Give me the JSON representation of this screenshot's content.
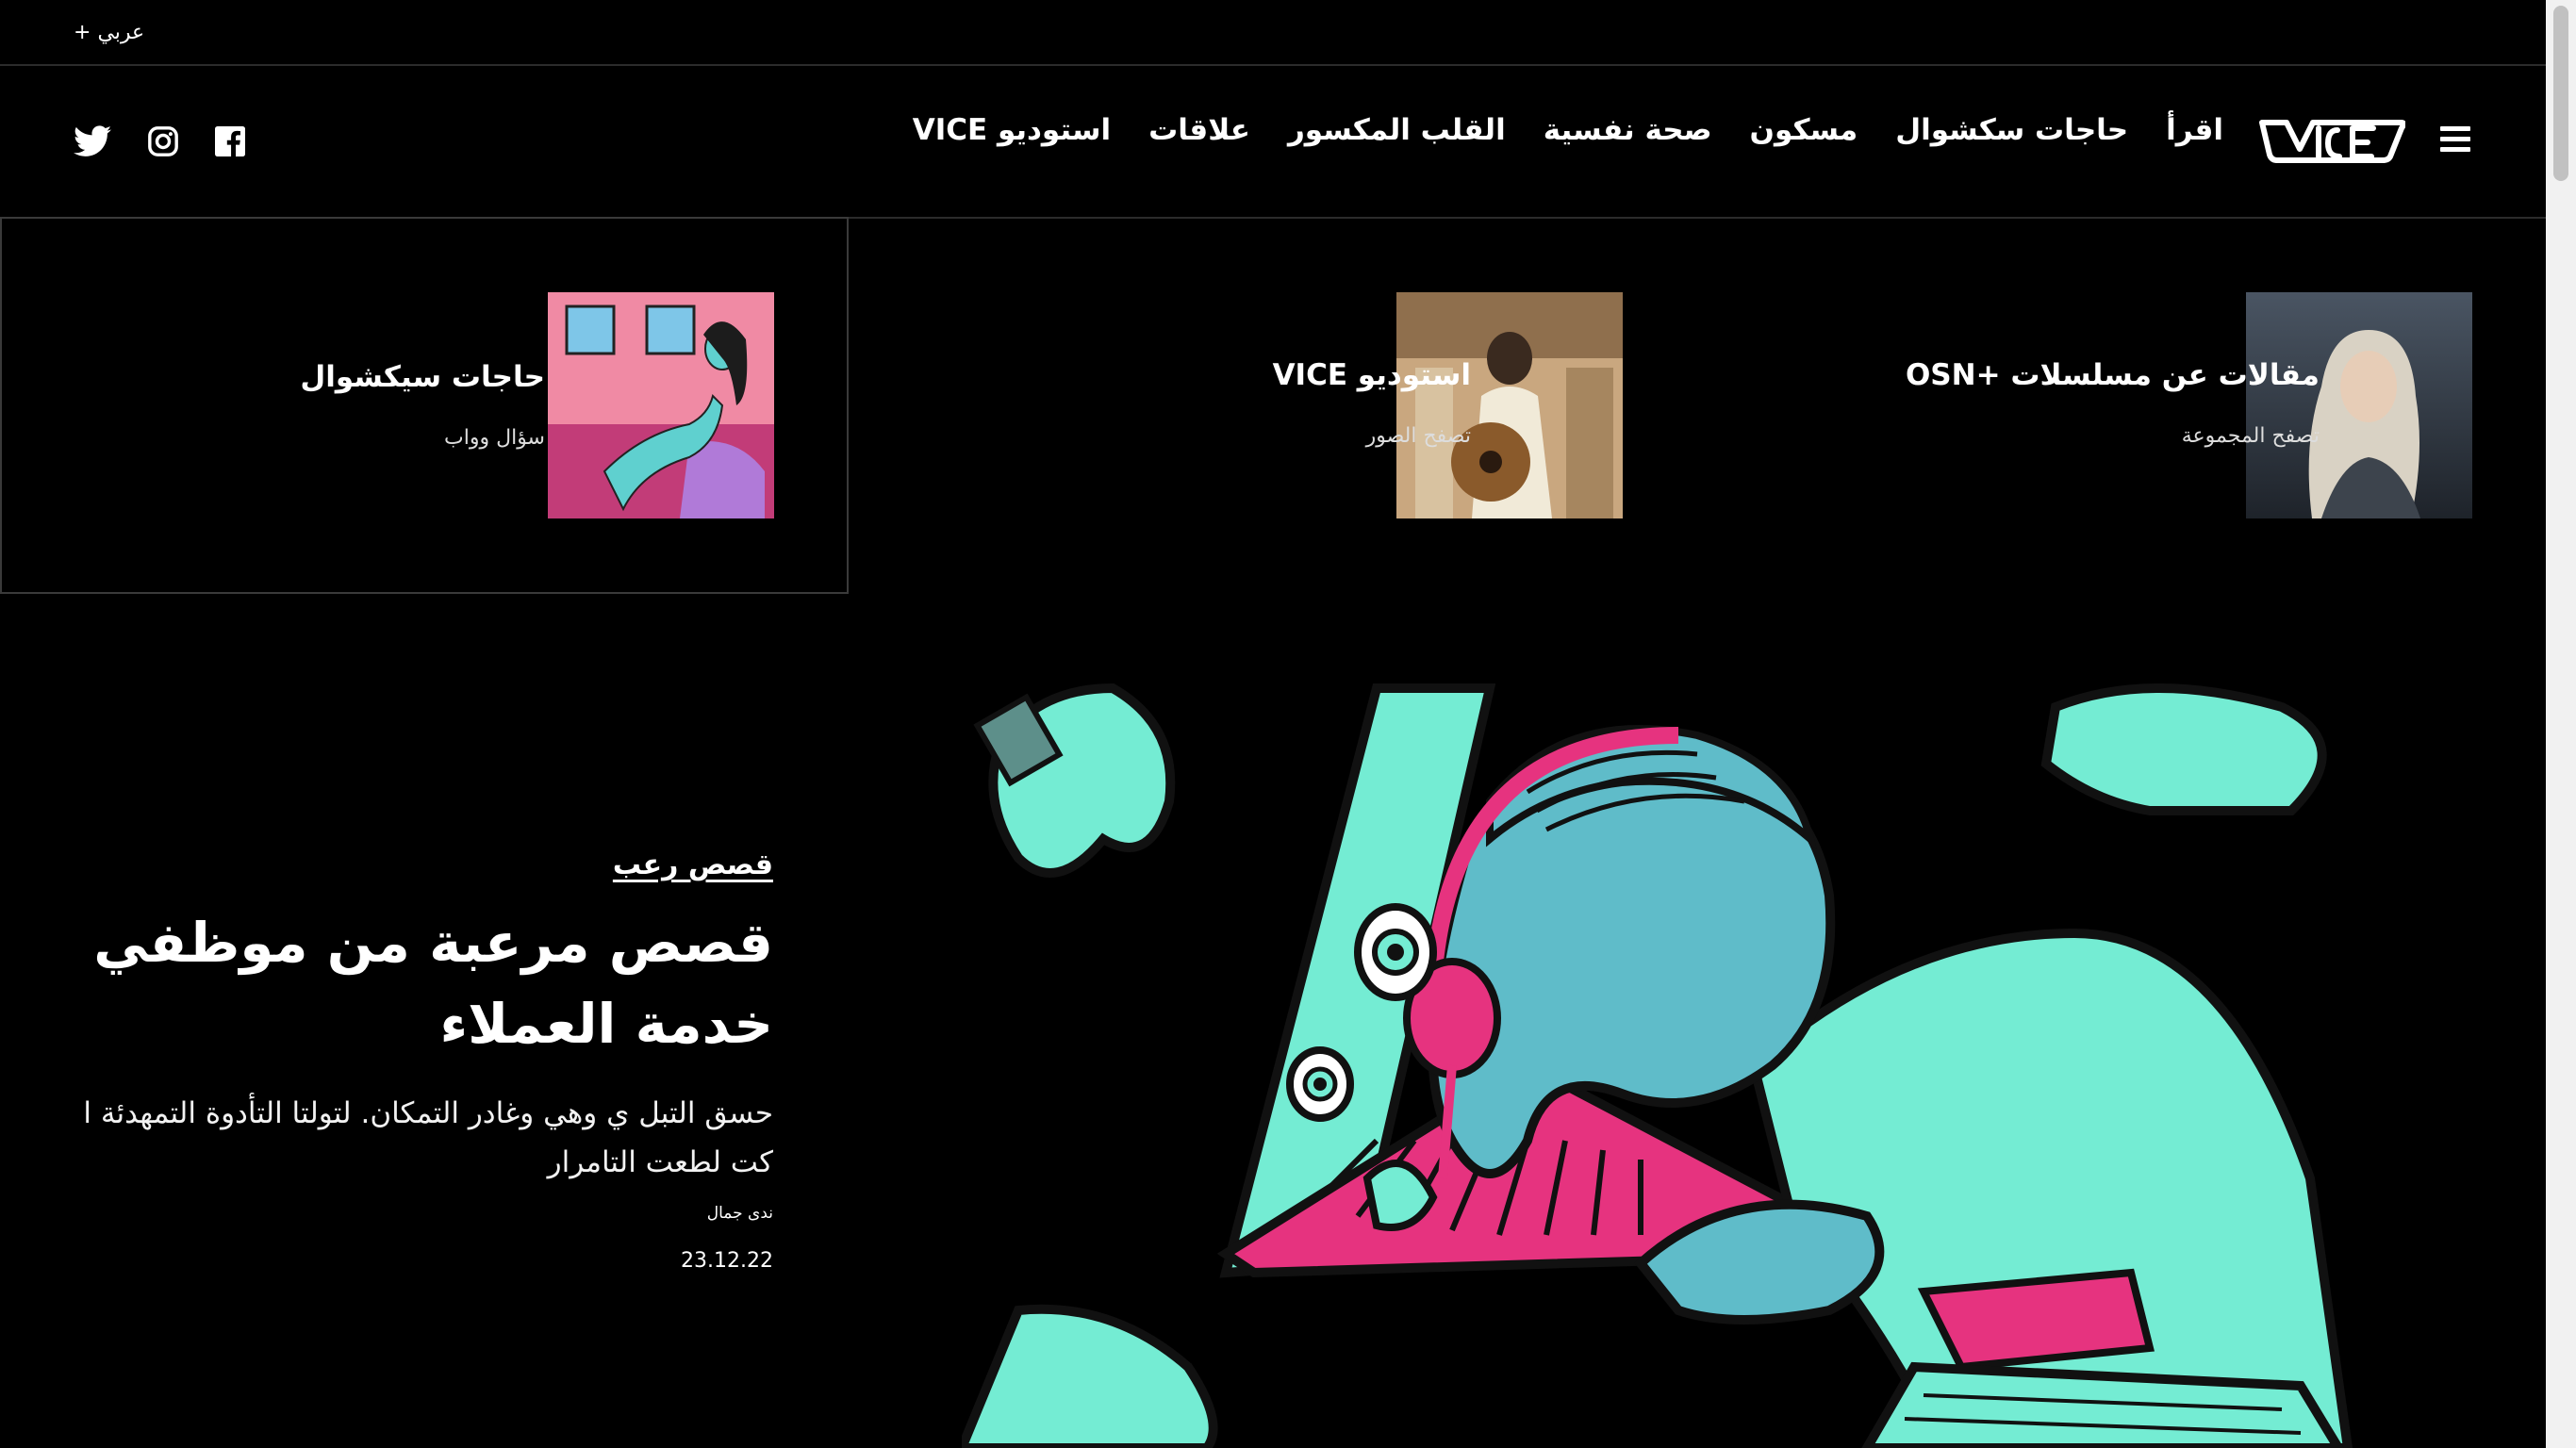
{
  "locale": {
    "label": "+ عربي"
  },
  "header": {
    "nav": [
      {
        "label": "اقرأ"
      },
      {
        "label": "حاجات سكشوال"
      },
      {
        "label": "مسكون"
      },
      {
        "label": "صحة نفسية"
      },
      {
        "label": "القلب المكسور"
      },
      {
        "label": "علاقات"
      },
      {
        "label": "استوديو VICE"
      }
    ],
    "logo_icon": "vice-logo",
    "menu_icon": "hamburger-icon",
    "social": [
      "twitter-icon",
      "instagram-icon",
      "facebook-icon"
    ]
  },
  "featured": [
    {
      "title": "مقالات عن مسلسلات +OSN",
      "subtitle": "تصفح المجموعة"
    },
    {
      "title": "استوديو VICE",
      "subtitle": "تصفح الصور"
    },
    {
      "title": "حاجات سيكشوال",
      "subtitle": "سؤال وواب"
    }
  ],
  "hero": {
    "kicker": "قصص رعب",
    "headline": "قصص مرعبة من موظفي خدمة العملاء",
    "dek": "حسق التبل ي وهي وغادر التمكان. لتولتا التأدوة التمهدئة ا كت لطعت التامرار",
    "author": "ندى جمال",
    "date": "23.12.22"
  },
  "colors": {
    "background": "#000000",
    "accent_teal": "#74ecd3",
    "accent_pink": "#e6337f",
    "skin_blue": "#5fbcc9"
  }
}
